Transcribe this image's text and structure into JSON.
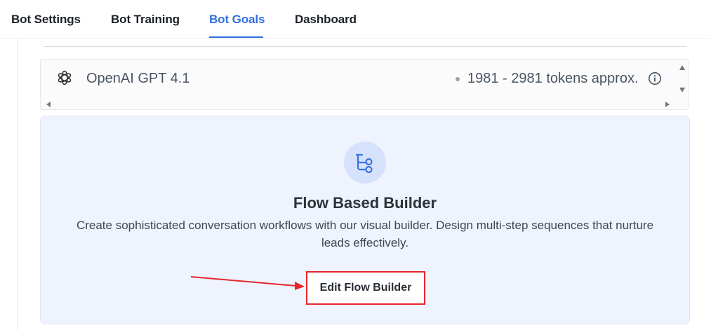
{
  "tabs": [
    {
      "label": "Bot Settings",
      "active": false
    },
    {
      "label": "Bot Training",
      "active": false
    },
    {
      "label": "Bot Goals",
      "active": true
    },
    {
      "label": "Dashboard",
      "active": false
    }
  ],
  "model_select": {
    "icon": "openai-icon",
    "model_name": "OpenAI GPT 4.1",
    "tokens": "1981 - 2981 tokens approx."
  },
  "flow_builder": {
    "icon": "flow-branch-icon",
    "title": "Flow Based Builder",
    "description": "Create sophisticated conversation workflows with our visual builder. Design multi-step sequences that nurture leads effectively.",
    "button_label": "Edit Flow Builder"
  },
  "colors": {
    "accent": "#2f6fe0",
    "card_background": "#eef3fd",
    "highlight": "#e5262a"
  }
}
